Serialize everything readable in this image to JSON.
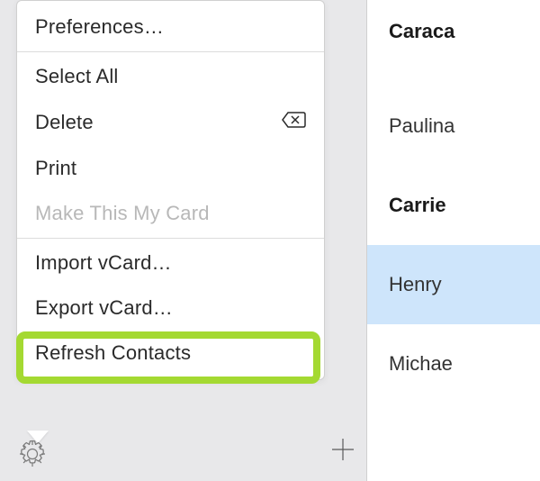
{
  "menu": {
    "preferences": "Preferences…",
    "select_all": "Select All",
    "delete": "Delete",
    "print": "Print",
    "make_my_card": "Make This My Card",
    "import_vcard": "Import vCard…",
    "export_vcard": "Export vCard…",
    "refresh_contacts": "Refresh Contacts"
  },
  "contacts": {
    "items": [
      {
        "name": "Caraca",
        "bold": true,
        "selected": false
      },
      {
        "name": "Paulina",
        "bold": false,
        "selected": false
      },
      {
        "name": "Carrie",
        "bold": true,
        "selected": false
      },
      {
        "name": "Henry",
        "bold": false,
        "selected": true
      },
      {
        "name": "Michae",
        "bold": false,
        "selected": false
      }
    ]
  },
  "icons": {
    "gear": "gear-icon",
    "plus": "plus-icon",
    "delete": "backspace-delete-icon"
  },
  "highlight": {
    "color": "#a4d932",
    "target": "export_vcard"
  }
}
